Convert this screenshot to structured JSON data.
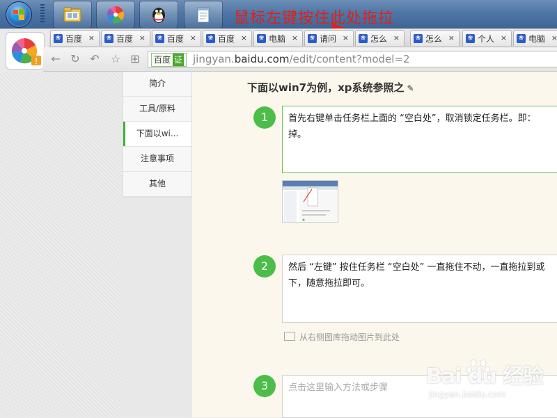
{
  "annotation": "鼠标左键按住此处拖拉",
  "tabs": [
    {
      "label": "百度"
    },
    {
      "label": "百度"
    },
    {
      "label": "百度"
    },
    {
      "label": "百度"
    },
    {
      "label": "电脑"
    },
    {
      "label": "请问"
    },
    {
      "label": "怎么"
    },
    {
      "label": "怎么"
    },
    {
      "label": "个人"
    },
    {
      "label": "电脑"
    }
  ],
  "tab_close": "×",
  "address": {
    "verify_label": "百度",
    "verify_badge": "证",
    "url_prefix": "jingyan.",
    "url_domain": "baidu.com",
    "url_path": "/edit/content?model=2"
  },
  "toc": {
    "items": [
      {
        "label": "简介"
      },
      {
        "label": "工具/原料"
      },
      {
        "label": "下面以wi..."
      },
      {
        "label": "注意事项"
      },
      {
        "label": "其他"
      }
    ]
  },
  "section": {
    "heading": "下面以win7为例，xp系统参照之",
    "edit_glyph": "✎"
  },
  "steps": [
    {
      "number": "1",
      "text": "首先右键单击任务栏上面的 “空白处”，取消锁定任务栏。即：掉。"
    },
    {
      "number": "2",
      "text": "然后 “左键” 按住任务栏 “空白处” 一直拖住不动，一直拖拉到或下，随意拖拉即可。"
    },
    {
      "number": "3",
      "placeholder": "点击这里输入方法或步骤"
    }
  ],
  "image_hint": "从右侧图库拖动图片到此处",
  "watermark": {
    "brand": "Bai du 经验",
    "site": "jingyan.baidu.com"
  },
  "colors": {
    "accent_green": "#4dbd4a",
    "annotation_red": "#e0201c",
    "taskbar_blue": "#4f76a6"
  }
}
